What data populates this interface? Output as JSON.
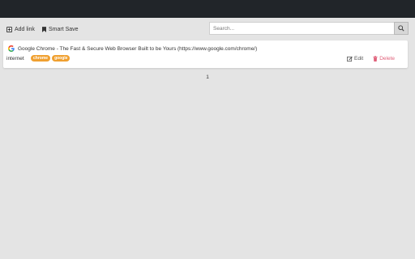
{
  "toolbar": {
    "add_link_label": "Add link",
    "smart_save_label": "Smart Save"
  },
  "search": {
    "placeholder": "Search...",
    "value": ""
  },
  "links": [
    {
      "title": "Google Chrome - The Fast & Secure Web Browser Built to be Yours (https://www.google.com/chrome/)",
      "favicon": "google-g-icon",
      "category": "internet",
      "tags": [
        "chrome",
        "google"
      ],
      "edit_label": "Edit",
      "delete_label": "Delete"
    }
  ],
  "pagination": {
    "current_page": "1"
  },
  "colors": {
    "topbar": "#212529",
    "background": "#e4e4e4",
    "tag": "#f0a030",
    "delete": "#e0607a"
  },
  "icons": {
    "add_link": "plus-square-icon",
    "smart_save": "bookmark-icon",
    "search": "magnifier-icon",
    "edit": "pencil-square-icon",
    "delete": "trash-icon"
  }
}
